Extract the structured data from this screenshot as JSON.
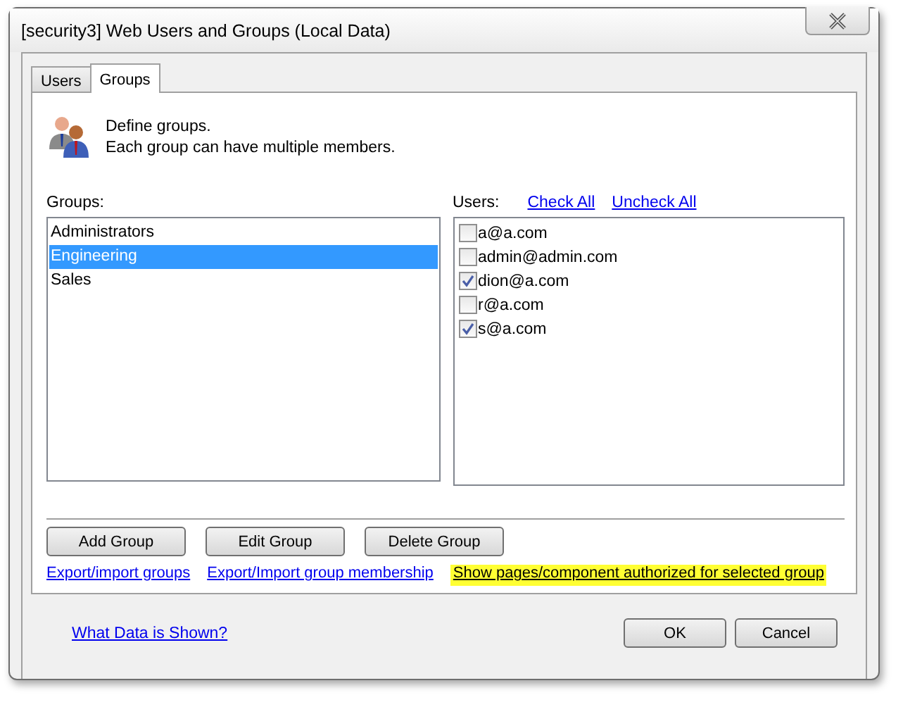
{
  "window": {
    "title": "[security3] Web Users and Groups (Local Data)"
  },
  "tabs": [
    {
      "label": "Users",
      "selected": false
    },
    {
      "label": "Groups",
      "selected": true
    }
  ],
  "intro": {
    "lines": [
      "Define groups.",
      "Each group can have multiple members."
    ]
  },
  "groups": {
    "label": "Groups:",
    "items": [
      {
        "name": "Administrators",
        "selected": false
      },
      {
        "name": "Engineering",
        "selected": true
      },
      {
        "name": "Sales",
        "selected": false
      }
    ]
  },
  "users": {
    "label": "Users:",
    "check_all": "Check All",
    "uncheck_all": "Uncheck All",
    "items": [
      {
        "email": "a@a.com",
        "checked": false
      },
      {
        "email": "admin@admin.com",
        "checked": false
      },
      {
        "email": "dion@a.com",
        "checked": true
      },
      {
        "email": "r@a.com",
        "checked": false
      },
      {
        "email": "s@a.com",
        "checked": true
      }
    ]
  },
  "group_buttons": [
    "Add Group",
    "Edit Group",
    "Delete Group"
  ],
  "links": [
    {
      "text": "Export/import groups",
      "highlighted": false
    },
    {
      "text": "Export/Import group membership",
      "highlighted": false
    },
    {
      "text": "Show pages/component authorized for selected group",
      "highlighted": true
    }
  ],
  "help_link": "What Data is Shown?",
  "dialog_buttons": [
    "OK",
    "Cancel"
  ]
}
